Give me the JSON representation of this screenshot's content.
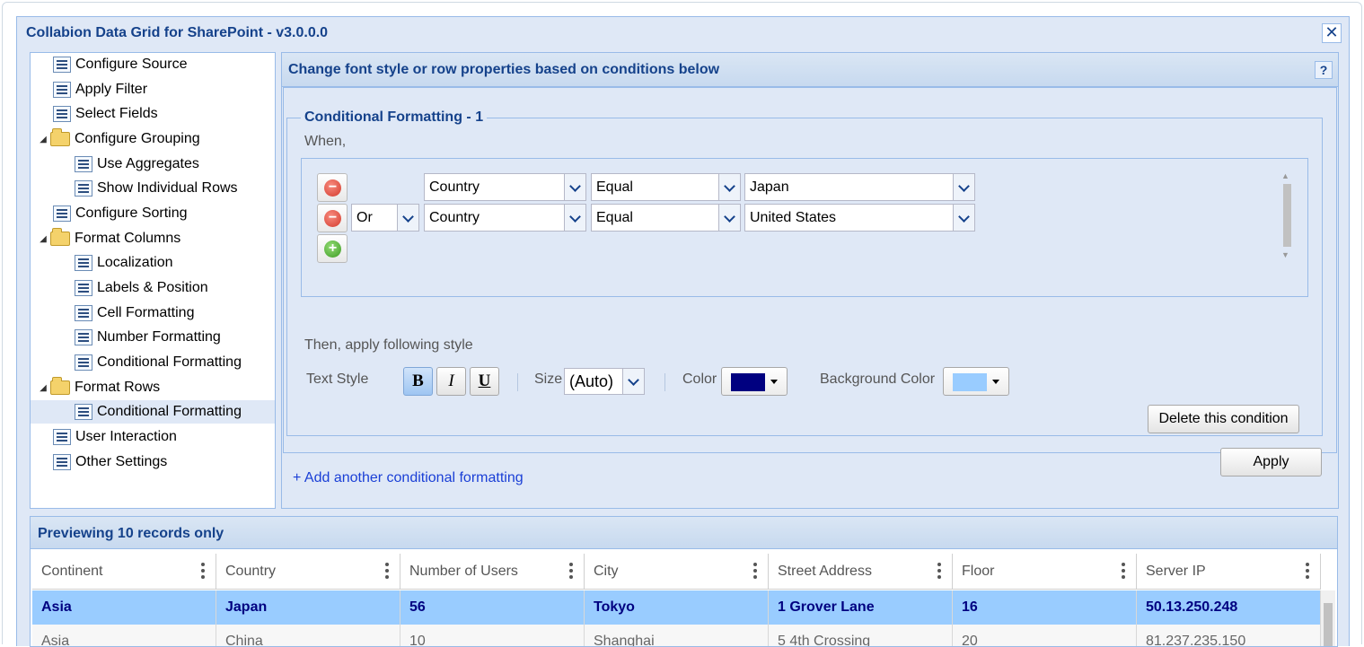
{
  "window": {
    "title": "Collabion Data Grid for SharePoint - v3.0.0.0",
    "close_glyph": "✕"
  },
  "tree": {
    "items": [
      {
        "label": "Configure Source"
      },
      {
        "label": "Apply Filter"
      },
      {
        "label": "Select Fields"
      },
      {
        "label": "Configure Grouping"
      },
      {
        "label": "Use Aggregates"
      },
      {
        "label": "Show Individual Rows"
      },
      {
        "label": "Configure Sorting"
      },
      {
        "label": "Format Columns"
      },
      {
        "label": "Localization"
      },
      {
        "label": "Labels & Position"
      },
      {
        "label": "Cell Formatting"
      },
      {
        "label": "Number Formatting"
      },
      {
        "label": "Conditional Formatting"
      },
      {
        "label": "Format Rows"
      },
      {
        "label": "Conditional Formatting"
      },
      {
        "label": "User Interaction"
      },
      {
        "label": "Other Settings"
      }
    ],
    "selected_label": "Conditional Formatting",
    "expander_glyph": "◢"
  },
  "panel": {
    "header": "Change font style or row properties based on conditions below",
    "help_glyph": "?",
    "legend": "Conditional Formatting - 1",
    "when_label": "When,",
    "conditions": [
      {
        "field": "Country",
        "operator": "Equal",
        "value": "Japan"
      },
      {
        "logic": "Or",
        "field": "Country",
        "operator": "Equal",
        "value": "United States"
      }
    ],
    "then_label": "Then, apply following style",
    "text_style_label": "Text Style",
    "bold_glyph": "B",
    "italic_glyph": "I",
    "underline_glyph": "U",
    "size_label": "Size",
    "size_value": "(Auto)",
    "color_label": "Color",
    "color_value": "#000080",
    "bg_color_label": "Background Color",
    "bg_color_value": "#99ccff",
    "delete_label": "Delete this condition",
    "add_link": "+ Add another conditional formatting",
    "apply_label": "Apply"
  },
  "preview": {
    "header": "Previewing 10 records only",
    "columns": [
      "Continent",
      "Country",
      "Number of Users",
      "City",
      "Street Address",
      "Floor",
      "Server IP"
    ],
    "rows": [
      [
        "Asia",
        "Japan",
        "56",
        "Tokyo",
        "1 Grover Lane",
        "16",
        "50.13.250.248"
      ],
      [
        "Asia",
        "China",
        "10",
        "Shanghai",
        "5 4th Crossing",
        "20",
        "81.237.235.150"
      ]
    ]
  },
  "colors": {
    "accent": "#15428b",
    "panel_bg": "#dfe8f6",
    "border": "#99bbe8",
    "highlight_row": "#99ccff",
    "link": "#1a3fd6"
  }
}
